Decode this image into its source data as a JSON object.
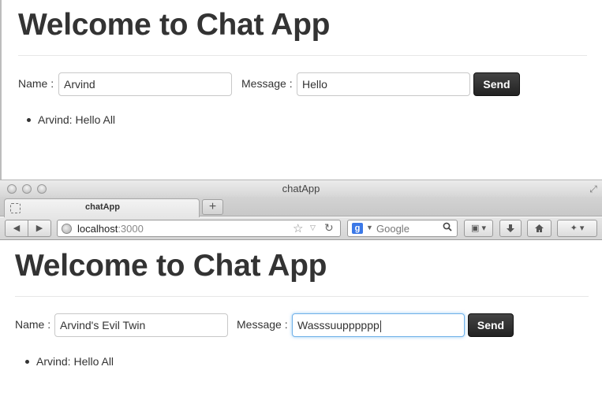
{
  "window1": {
    "title": "Welcome to Chat App",
    "name_label": "Name :",
    "name_value": "Arvind",
    "message_label": "Message :",
    "message_value": "Hello",
    "send_label": "Send",
    "messages": [
      "Arvind: Hello All"
    ]
  },
  "browser": {
    "window_title": "chatApp",
    "tab_label": "chatApp",
    "new_tab_glyph": "+",
    "back_glyph": "◀",
    "forward_glyph": "▶",
    "url_host": "localhost",
    "url_port": ":3000",
    "star_glyph": "☆",
    "reload_glyph": "↻",
    "search_engine_glyph": "g",
    "search_placeholder": "Google",
    "icons": [
      "globe-icon",
      "bookmark-star-icon",
      "reload-icon",
      "search-icon",
      "bookmarks-menu-icon",
      "download-icon",
      "home-icon",
      "addons-icon"
    ]
  },
  "window2": {
    "title": "Welcome to Chat App",
    "name_label": "Name :",
    "name_value": "Arvind's Evil Twin",
    "message_label": "Message :",
    "message_value": "Wasssuupppppp",
    "send_label": "Send",
    "messages": [
      "Arvind: Hello All"
    ]
  },
  "colors": {
    "send_button": "#222222",
    "focus_ring": "#6fb0e8",
    "text": "#333333"
  }
}
